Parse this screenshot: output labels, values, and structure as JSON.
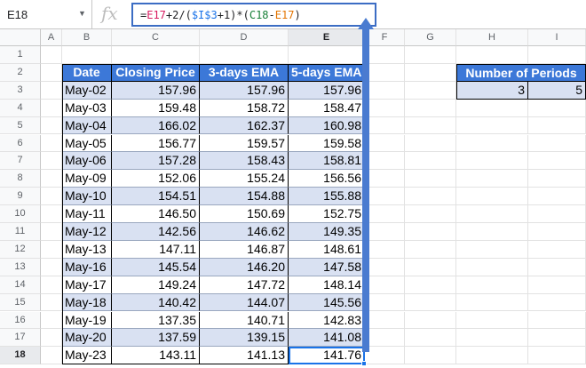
{
  "formula_bar": {
    "name_box": "E18",
    "fx_symbol": "fx",
    "formula_parts": [
      "=",
      "E17",
      "+2/(",
      "$I$3",
      "+1)*(",
      "C18",
      "-",
      "E17",
      ")"
    ]
  },
  "columns": [
    "A",
    "B",
    "C",
    "D",
    "E",
    "F",
    "G",
    "H",
    "I"
  ],
  "rows": [
    "1",
    "2",
    "3",
    "4",
    "5",
    "6",
    "7",
    "8",
    "9",
    "10",
    "11",
    "12",
    "13",
    "14",
    "15",
    "16",
    "17",
    "18"
  ],
  "table": {
    "headers": [
      "Date",
      "Closing Price",
      "3-days EMA",
      "5-days EMA"
    ],
    "rows": [
      [
        "May-02",
        "157.96",
        "157.96",
        "157.96"
      ],
      [
        "May-03",
        "159.48",
        "158.72",
        "158.47"
      ],
      [
        "May-04",
        "166.02",
        "162.37",
        "160.98"
      ],
      [
        "May-05",
        "156.77",
        "159.57",
        "159.58"
      ],
      [
        "May-06",
        "157.28",
        "158.43",
        "158.81"
      ],
      [
        "May-09",
        "152.06",
        "155.24",
        "156.56"
      ],
      [
        "May-10",
        "154.51",
        "154.88",
        "155.88"
      ],
      [
        "May-11",
        "146.50",
        "150.69",
        "152.75"
      ],
      [
        "May-12",
        "142.56",
        "146.62",
        "149.35"
      ],
      [
        "May-13",
        "147.11",
        "146.87",
        "148.61"
      ],
      [
        "May-16",
        "145.54",
        "146.20",
        "147.58"
      ],
      [
        "May-17",
        "149.24",
        "147.72",
        "148.14"
      ],
      [
        "May-18",
        "140.42",
        "144.07",
        "145.56"
      ],
      [
        "May-19",
        "137.35",
        "140.71",
        "142.83"
      ],
      [
        "May-20",
        "137.59",
        "139.15",
        "141.08"
      ],
      [
        "May-23",
        "143.11",
        "141.13",
        "141.76"
      ]
    ]
  },
  "periods": {
    "header": "Number of Periods",
    "values": [
      "3",
      "5"
    ]
  },
  "colors": {
    "header_fill": "#3c78d8",
    "band_fill": "#d9e1f2",
    "selection": "#1a73e8",
    "arrow": "#4a7bd0"
  }
}
